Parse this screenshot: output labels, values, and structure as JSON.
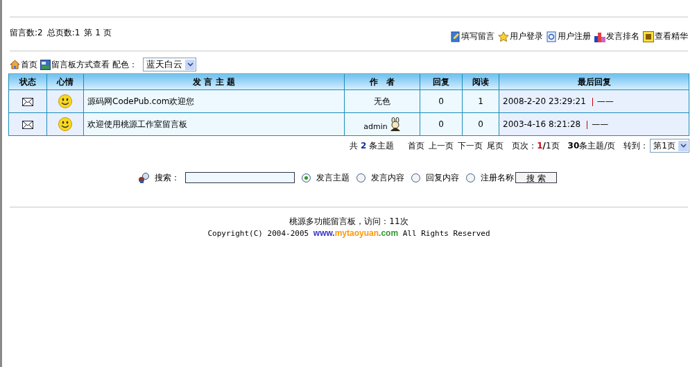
{
  "stats": {
    "count_label": "留言数:2",
    "pages_label": "总页数:1",
    "page_label": "第 1 页"
  },
  "top_links": [
    {
      "kind": "write",
      "label": "填写留言"
    },
    {
      "kind": "login",
      "label": "用户登录"
    },
    {
      "kind": "register",
      "label": "用户注册"
    },
    {
      "kind": "ranking",
      "label": "发言排名"
    },
    {
      "kind": "featured",
      "label": "查看精华"
    }
  ],
  "nav": {
    "home": "首页",
    "board_view": "留言板方式查看",
    "color_label": "配色：",
    "color_value": "蓝天白云"
  },
  "table": {
    "columns": [
      "状态",
      "心情",
      "发 言 主 题",
      "作　者",
      "回复",
      "阅读",
      "最后回复"
    ],
    "rows": [
      {
        "subject": "源码网CodePub.com欢迎您",
        "author": "无色",
        "author_avatar": false,
        "replies": "0",
        "reads": "1",
        "last_reply": "2008-2-20 23:29:21",
        "last_user": "——"
      },
      {
        "subject": "欢迎使用桃源工作室留言板",
        "author": "admin",
        "author_avatar": true,
        "replies": "0",
        "reads": "0",
        "last_reply": "2003-4-16 8:21:28",
        "last_user": "——"
      }
    ]
  },
  "pager": {
    "total_prefix": "共",
    "total": "2",
    "total_suffix": "条主题",
    "links": [
      "首页",
      "上一页",
      "下一页",
      "尾页"
    ],
    "page_label": "页次：",
    "page_current": "1",
    "page_total": "/1页",
    "per_page": "30",
    "per_page_suffix": "条主题/页",
    "goto_label": "转到：",
    "goto_value": "第1页"
  },
  "search": {
    "label": "搜索：",
    "scopes": [
      {
        "label": "发言主题",
        "selected": true
      },
      {
        "label": "发言内容",
        "selected": false
      },
      {
        "label": "回复内容",
        "selected": false
      },
      {
        "label": "注册名称",
        "selected": false
      }
    ],
    "button": "搜 索"
  },
  "footer": {
    "line": "桃源多功能留言板，访问：11次",
    "copyright_prefix": "Copyright(C) 2004-2005",
    "link_parts": [
      {
        "text": "www.",
        "color": "#3333cc"
      },
      {
        "text": "mytaoyuan",
        "color": "#ff9900"
      },
      {
        "text": ".com",
        "color": "#339933"
      }
    ],
    "copyright_suffix": "All Rights Reserved"
  }
}
